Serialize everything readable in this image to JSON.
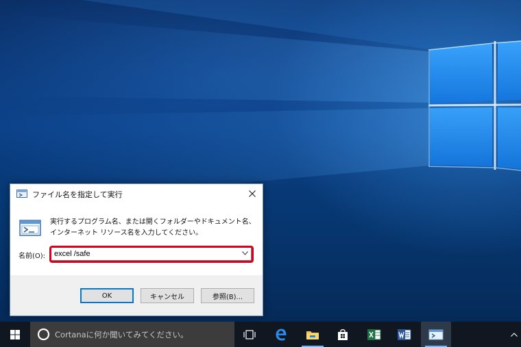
{
  "dialog": {
    "title": "ファイル名を指定して実行",
    "description": "実行するプログラム名、または開くフォルダーやドキュメント名、インターネット リソース名を入力してください。",
    "name_label": "名前(O):",
    "name_value": "excel /safe",
    "ok_label": "OK",
    "cancel_label": "キャンセル",
    "browse_label": "参照(B)...",
    "icons": {
      "title": "run-icon",
      "body": "run-icon",
      "close": "close-icon",
      "dropdown": "chevron-down-icon"
    }
  },
  "taskbar": {
    "search_placeholder": "Cortanaに何か聞いてみてください。",
    "items": [
      {
        "name": "task-view",
        "icon": "task-view-icon"
      },
      {
        "name": "edge",
        "icon": "edge-icon"
      },
      {
        "name": "file-explorer",
        "icon": "folder-icon"
      },
      {
        "name": "store",
        "icon": "store-icon"
      },
      {
        "name": "excel",
        "icon": "excel-icon"
      },
      {
        "name": "word",
        "icon": "word-icon"
      },
      {
        "name": "run",
        "icon": "run-icon",
        "active": true
      }
    ]
  },
  "colors": {
    "highlight": "#d6021d",
    "accent": "#0078d7",
    "taskbar": "#101721",
    "search_box": "#3c3c3c"
  }
}
